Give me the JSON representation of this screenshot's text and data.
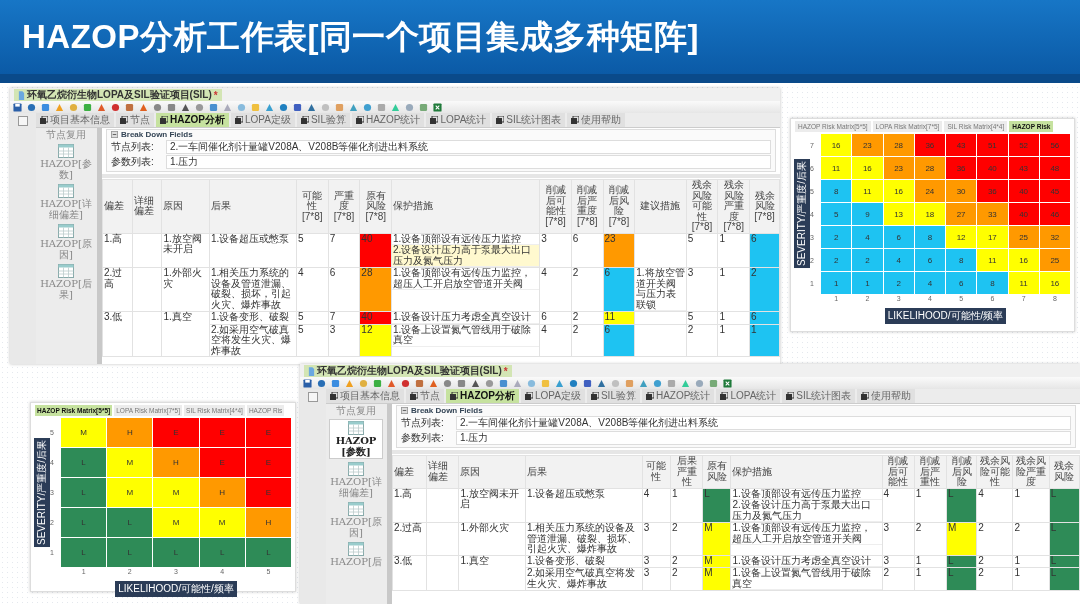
{
  "title": "HAZOP分析工作表[同一个项目集成多种矩阵]",
  "worksheet_top": {
    "document_tab": {
      "label": "环氧乙烷衍生物LOPA及SIL验证项目(SIL)",
      "modified_mark": "*"
    },
    "tabs": [
      {
        "label": "项目基本信息",
        "selected": false
      },
      {
        "label": "节点",
        "selected": false
      },
      {
        "label": "HAZOP分析",
        "selected": true
      },
      {
        "label": "LOPA定级",
        "selected": false
      },
      {
        "label": "SIL验算",
        "selected": false
      },
      {
        "label": "HAZOP统计",
        "selected": false
      },
      {
        "label": "LOPA统计",
        "selected": false
      },
      {
        "label": "SIL统计图表",
        "selected": false
      },
      {
        "label": "使用帮助",
        "selected": false
      }
    ],
    "sidebar": [
      {
        "label": "节点复用",
        "selected": false
      },
      {
        "label": "HAZOP[参数]",
        "selected": false
      },
      {
        "label": "HAZOP[详细偏差]",
        "selected": false
      },
      {
        "label": "HAZOP[原因]",
        "selected": false
      },
      {
        "label": "HAZOP[后果]",
        "selected": false
      }
    ],
    "section_title": "Break Down Fields",
    "fields": [
      {
        "label": "节点列表:",
        "value": "2.一车间催化剂计量罐V208A、V208B等催化剂进出料系统"
      },
      {
        "label": "参数列表:",
        "value": "1.压力"
      }
    ],
    "columns": [
      {
        "label": "偏差",
        "kind": "deviation"
      },
      {
        "label": "详细偏差",
        "kind": "detail"
      },
      {
        "label": "原因",
        "kind": "cause"
      },
      {
        "label": "后果",
        "kind": "consequence"
      },
      {
        "label": "可能性[7*8]",
        "kind": "likelihood"
      },
      {
        "label": "严重度[7*8]",
        "kind": "severity"
      },
      {
        "label": "原有风险[7*8]",
        "kind": "risk"
      },
      {
        "label": "保护措施",
        "kind": "protection"
      },
      {
        "label": "削减后可能性[7*8]",
        "kind": "mitigated_likelihood"
      },
      {
        "label": "削减后严重度[7*8]",
        "kind": "mitigated_severity"
      },
      {
        "label": "削减后风险[7*8]",
        "kind": "mitigated_risk"
      },
      {
        "label": "建议措施",
        "kind": "suggestion"
      },
      {
        "label": "残余风险可能性[7*8]",
        "kind": "residual_likelihood"
      },
      {
        "label": "残余风险严重度[7*8]",
        "kind": "residual_severity"
      },
      {
        "label": "残余风险[7*8]",
        "kind": "residual_risk"
      }
    ],
    "rows": [
      {
        "deviation": "1.高",
        "cause": "1.放空阀未开启",
        "consequences": [
          {
            "consequence": "1.设备超压或憋泵",
            "likelihood": "5",
            "severity": "7",
            "risk": {
              "label": "40",
              "color": "#ff0000"
            },
            "protection": [
              {
                "text": "1.设备顶部设有远传压力监控",
                "selected": false
              },
              {
                "text": "2.设备设计压力高于泵最大出口压力及氮气压力",
                "selected": true
              }
            ],
            "mitigated_likelihood": "3",
            "mitigated_severity": "6",
            "mitigated_risk": {
              "label": "23",
              "color": "#ff9900"
            },
            "residual_likelihood": "5",
            "residual_severity": "1",
            "residual_risk": {
              "label": "6",
              "color": "#1ec3f2"
            }
          }
        ]
      },
      {
        "deviation": "2.过高",
        "cause": "1.外部火灾",
        "consequences": [
          {
            "consequence": "1.相关压力系统的设备及管道泄漏、破裂、损坏，引起火灾、爆炸事故",
            "likelihood": "4",
            "severity": "6",
            "risk": {
              "label": "28",
              "color": "#ff9900"
            },
            "protection": [
              {
                "text": "1.设备顶部设有远传压力监控，超压人工开启放空管道开关阀",
                "selected": false
              }
            ],
            "mitigated_likelihood": "4",
            "mitigated_severity": "2",
            "mitigated_risk": {
              "label": "6",
              "color": "#1ec3f2"
            },
            "suggestion": [
              "1.将放空管道开关阀与压力表联锁"
            ],
            "residual_likelihood": "3",
            "residual_severity": "1",
            "residual_risk": {
              "label": "2",
              "color": "#1ec3f2"
            }
          }
        ]
      },
      {
        "deviation": "3.低",
        "cause": "1.真空",
        "consequences": [
          {
            "consequence": "1.设备变形、破裂",
            "likelihood": "5",
            "severity": "7",
            "risk": {
              "label": "40",
              "color": "#ff0000"
            },
            "protection": [
              {
                "text": "1.设备设计压力考虑全真空设计",
                "selected": false
              }
            ],
            "mitigated_likelihood": "6",
            "mitigated_severity": "2",
            "mitigated_risk": {
              "label": "11",
              "color": "#ffff00"
            },
            "residual_likelihood": "5",
            "residual_severity": "1",
            "residual_risk": {
              "label": "6",
              "color": "#1ec3f2"
            }
          },
          {
            "consequence": "2.如采用空气破真空将发生火灾、爆炸事故",
            "likelihood": "5",
            "severity": "3",
            "risk": {
              "label": "12",
              "color": "#ffff00"
            },
            "protection": [
              {
                "text": "1.设备上设置氮气管线用于破除真空",
                "selected": false
              }
            ],
            "mitigated_likelihood": "4",
            "mitigated_severity": "2",
            "mitigated_risk": {
              "label": "6",
              "color": "#1ec3f2"
            },
            "residual_likelihood": "2",
            "residual_severity": "1",
            "residual_risk": {
              "label": "1",
              "color": "#1ec3f2"
            }
          }
        ]
      }
    ]
  },
  "matrix_right": {
    "tabs": [
      {
        "label": "HAZOP Risk Matrix[5*5]",
        "selected": false
      },
      {
        "label": "LOPA Risk Matrix[7*5]",
        "selected": false
      },
      {
        "label": "SIL Risk Matrix[4*4]",
        "selected": false
      },
      {
        "label": "HAZOP Risk",
        "selected": true
      }
    ],
    "ylabel": "SEVERITY/严重度/后果",
    "xlabel": "LIKELIHOOD/可能性/频率",
    "rows": [
      {
        "severity": "7",
        "cells": [
          {
            "label": "16",
            "color": "#ffff00"
          },
          {
            "label": "23",
            "color": "#ff9900"
          },
          {
            "label": "28",
            "color": "#ff9900"
          },
          {
            "label": "36",
            "color": "#ff0000"
          },
          {
            "label": "43",
            "color": "#ff0000"
          },
          {
            "label": "51",
            "color": "#ff0000"
          },
          {
            "label": "52",
            "color": "#ff0000"
          },
          {
            "label": "56",
            "color": "#ff0000"
          }
        ]
      },
      {
        "severity": "6",
        "cells": [
          {
            "label": "11",
            "color": "#ffff00"
          },
          {
            "label": "16",
            "color": "#ffff00"
          },
          {
            "label": "23",
            "color": "#ff9900"
          },
          {
            "label": "28",
            "color": "#ff9900"
          },
          {
            "label": "36",
            "color": "#ff0000"
          },
          {
            "label": "40",
            "color": "#ff0000"
          },
          {
            "label": "43",
            "color": "#ff0000"
          },
          {
            "label": "48",
            "color": "#ff0000"
          }
        ]
      },
      {
        "severity": "5",
        "cells": [
          {
            "label": "8",
            "color": "#1ec3f2"
          },
          {
            "label": "11",
            "color": "#ffff00"
          },
          {
            "label": "16",
            "color": "#ffff00"
          },
          {
            "label": "24",
            "color": "#ff9900"
          },
          {
            "label": "30",
            "color": "#ff9900"
          },
          {
            "label": "36",
            "color": "#ff0000"
          },
          {
            "label": "40",
            "color": "#ff0000"
          },
          {
            "label": "45",
            "color": "#ff0000"
          }
        ]
      },
      {
        "severity": "4",
        "cells": [
          {
            "label": "5",
            "color": "#1ec3f2"
          },
          {
            "label": "9",
            "color": "#1ec3f2"
          },
          {
            "label": "13",
            "color": "#ffff00"
          },
          {
            "label": "18",
            "color": "#ffff00"
          },
          {
            "label": "27",
            "color": "#ff9900"
          },
          {
            "label": "33",
            "color": "#ff9900"
          },
          {
            "label": "40",
            "color": "#ff0000"
          },
          {
            "label": "46",
            "color": "#ff0000"
          }
        ]
      },
      {
        "severity": "3",
        "cells": [
          {
            "label": "2",
            "color": "#1ec3f2"
          },
          {
            "label": "4",
            "color": "#1ec3f2"
          },
          {
            "label": "6",
            "color": "#1ec3f2"
          },
          {
            "label": "8",
            "color": "#1ec3f2"
          },
          {
            "label": "12",
            "color": "#ffff00"
          },
          {
            "label": "17",
            "color": "#ffff00"
          },
          {
            "label": "25",
            "color": "#ff9900"
          },
          {
            "label": "32",
            "color": "#ff9900"
          }
        ]
      },
      {
        "severity": "2",
        "cells": [
          {
            "label": "2",
            "color": "#1ec3f2"
          },
          {
            "label": "2",
            "color": "#1ec3f2"
          },
          {
            "label": "4",
            "color": "#1ec3f2"
          },
          {
            "label": "6",
            "color": "#1ec3f2"
          },
          {
            "label": "8",
            "color": "#1ec3f2"
          },
          {
            "label": "11",
            "color": "#ffff00"
          },
          {
            "label": "16",
            "color": "#ffff00"
          },
          {
            "label": "25",
            "color": "#ff9900"
          }
        ]
      },
      {
        "severity": "1",
        "cells": [
          {
            "label": "1",
            "color": "#1ec3f2"
          },
          {
            "label": "1",
            "color": "#1ec3f2"
          },
          {
            "label": "2",
            "color": "#1ec3f2"
          },
          {
            "label": "4",
            "color": "#1ec3f2"
          },
          {
            "label": "6",
            "color": "#1ec3f2"
          },
          {
            "label": "8",
            "color": "#1ec3f2"
          },
          {
            "label": "11",
            "color": "#ffff00"
          },
          {
            "label": "16",
            "color": "#ffff00"
          }
        ]
      }
    ],
    "likelihood_ticks": [
      "1",
      "2",
      "3",
      "4",
      "5",
      "6",
      "7",
      "8"
    ]
  },
  "matrix_left": {
    "tabs": [
      {
        "label": "HAZOP Risk Matrix[5*5]",
        "selected": true
      },
      {
        "label": "LOPA Risk Matrix[7*5]",
        "selected": false
      },
      {
        "label": "SIL Risk Matrix[4*4]",
        "selected": false
      },
      {
        "label": "HAZOP Ris",
        "selected": false
      }
    ],
    "ylabel": "SEVERITY/严重度/后果",
    "xlabel": "LIKELIHOOD/可能性/频率",
    "rows": [
      {
        "severity": "5",
        "cells": [
          {
            "label": "M",
            "color": "#ffff00"
          },
          {
            "label": "H",
            "color": "#ff9900"
          },
          {
            "label": "E",
            "color": "#ff0000"
          },
          {
            "label": "E",
            "color": "#ff0000"
          },
          {
            "label": "E",
            "color": "#ff0000"
          }
        ]
      },
      {
        "severity": "4",
        "cells": [
          {
            "label": "L",
            "color": "#2e8b57"
          },
          {
            "label": "M",
            "color": "#ffff00"
          },
          {
            "label": "H",
            "color": "#ff9900"
          },
          {
            "label": "E",
            "color": "#ff0000"
          },
          {
            "label": "E",
            "color": "#ff0000"
          }
        ]
      },
      {
        "severity": "3",
        "cells": [
          {
            "label": "L",
            "color": "#2e8b57"
          },
          {
            "label": "M",
            "color": "#ffff00"
          },
          {
            "label": "M",
            "color": "#ffff00"
          },
          {
            "label": "H",
            "color": "#ff9900"
          },
          {
            "label": "E",
            "color": "#ff0000"
          }
        ]
      },
      {
        "severity": "2",
        "cells": [
          {
            "label": "L",
            "color": "#2e8b57"
          },
          {
            "label": "L",
            "color": "#2e8b57"
          },
          {
            "label": "M",
            "color": "#ffff00"
          },
          {
            "label": "M",
            "color": "#ffff00"
          },
          {
            "label": "H",
            "color": "#ff9900"
          }
        ]
      },
      {
        "severity": "1",
        "cells": [
          {
            "label": "L",
            "color": "#2e8b57"
          },
          {
            "label": "L",
            "color": "#2e8b57"
          },
          {
            "label": "L",
            "color": "#2e8b57"
          },
          {
            "label": "L",
            "color": "#2e8b57"
          },
          {
            "label": "L",
            "color": "#2e8b57"
          }
        ]
      }
    ],
    "likelihood_ticks": [
      "1",
      "2",
      "3",
      "4",
      "5"
    ]
  },
  "worksheet_bottom": {
    "document_tab": {
      "label": "环氧乙烷衍生物LOPA及SIL验证项目(SIL)",
      "modified_mark": "*"
    },
    "tabs": [
      {
        "label": "项目基本信息",
        "selected": false
      },
      {
        "label": "节点",
        "selected": false
      },
      {
        "label": "HAZOP分析",
        "selected": true
      },
      {
        "label": "LOPA定级",
        "selected": false
      },
      {
        "label": "SIL验算",
        "selected": false
      },
      {
        "label": "HAZOP统计",
        "selected": false
      },
      {
        "label": "LOPA统计",
        "selected": false
      },
      {
        "label": "SIL统计图表",
        "selected": false
      },
      {
        "label": "使用帮助",
        "selected": false
      }
    ],
    "sidebar": [
      {
        "label": "节点复用",
        "selected": false
      },
      {
        "label": "HAZOP[参数]",
        "selected": true
      },
      {
        "label": "HAZOP[详细偏差]",
        "selected": false
      },
      {
        "label": "HAZOP[原因]",
        "selected": false
      },
      {
        "label": "HAZOP[后",
        "selected": false
      }
    ],
    "section_title": "Break Down Fields",
    "fields": [
      {
        "label": "节点列表:",
        "value": "2.一车间催化剂计量罐V208A、V208B等催化剂进出料系统"
      },
      {
        "label": "参数列表:",
        "value": "1.压力"
      }
    ],
    "columns": [
      {
        "label": "偏差",
        "kind": "deviation"
      },
      {
        "label": "详细偏差",
        "kind": "detail"
      },
      {
        "label": "原因",
        "kind": "cause"
      },
      {
        "label": "后果",
        "kind": "consequence"
      },
      {
        "label": "可能性",
        "kind": "likelihood"
      },
      {
        "label": "后果严重性",
        "kind": "severity"
      },
      {
        "label": "原有风险",
        "kind": "risk"
      },
      {
        "label": "保护措施",
        "kind": "protection"
      },
      {
        "label": "削减后可能性",
        "kind": "mitigated_likelihood"
      },
      {
        "label": "削减后严重性",
        "kind": "mitigated_severity"
      },
      {
        "label": "削减后风险",
        "kind": "mitigated_risk"
      },
      {
        "label": "残余风险可能性",
        "kind": "residual_likelihood"
      },
      {
        "label": "残余风险严重度",
        "kind": "residual_severity"
      },
      {
        "label": "残余风险",
        "kind": "residual_risk"
      }
    ],
    "rows": [
      {
        "deviation": "1.高",
        "cause": "1.放空阀未开启",
        "consequences": [
          {
            "consequence": "1.设备超压或憋泵",
            "likelihood": "4",
            "severity": "1",
            "risk": {
              "label": "L",
              "color": "#2e8b57"
            },
            "protection": [
              {
                "text": "1.设备顶部设有远传压力监控",
                "selected": false
              },
              {
                "text": "2.设备设计压力高于泵最大出口压力及氮气压力",
                "selected": false
              }
            ],
            "mitigated_likelihood": "4",
            "mitigated_severity": "1",
            "mitigated_risk": {
              "label": "L",
              "color": "#2e8b57"
            },
            "residual_likelihood": "4",
            "residual_severity": "1",
            "residual_risk": {
              "label": "L",
              "color": "#2e8b57"
            }
          }
        ]
      },
      {
        "deviation": "2.过高",
        "cause": "1.外部火灾",
        "consequences": [
          {
            "consequence": "1.相关压力系统的设备及管道泄漏、破裂、损坏、引起火灾、爆炸事故",
            "likelihood": "3",
            "severity": "2",
            "risk": {
              "label": "M",
              "color": "#ffff00"
            },
            "protection": [
              {
                "text": "1.设备顶部设有远传压力监控，超压人工开启放空管道开关阀",
                "selected": false
              }
            ],
            "mitigated_likelihood": "3",
            "mitigated_severity": "2",
            "mitigated_risk": {
              "label": "M",
              "color": "#ffff00"
            },
            "residual_likelihood": "2",
            "residual_severity": "2",
            "residual_risk": {
              "label": "L",
              "color": "#2e8b57"
            }
          }
        ]
      },
      {
        "deviation": "3.低",
        "cause": "1.真空",
        "consequences": [
          {
            "consequence": "1.设备变形、破裂",
            "likelihood": "3",
            "severity": "2",
            "risk": {
              "label": "M",
              "color": "#ffff00"
            },
            "protection": [
              {
                "text": "1.设备设计压力考虑全真空设计",
                "selected": false
              }
            ],
            "mitigated_likelihood": "3",
            "mitigated_severity": "1",
            "mitigated_risk": {
              "label": "L",
              "color": "#2e8b57"
            },
            "residual_likelihood": "2",
            "residual_severity": "1",
            "residual_risk": {
              "label": "L",
              "color": "#2e8b57"
            }
          },
          {
            "consequence": "2.如采用空气破真空将发生火灾、爆炸事故",
            "likelihood": "3",
            "severity": "2",
            "risk": {
              "label": "M",
              "color": "#ffff00"
            },
            "protection": [
              {
                "text": "1.设备上设置氮气管线用于破除真空",
                "selected": false
              }
            ],
            "mitigated_likelihood": "2",
            "mitigated_severity": "1",
            "mitigated_risk": {
              "label": "L",
              "color": "#2e8b57"
            },
            "residual_likelihood": "2",
            "residual_severity": "1",
            "residual_risk": {
              "label": "L",
              "color": "#2e8b57"
            }
          }
        ]
      }
    ]
  }
}
